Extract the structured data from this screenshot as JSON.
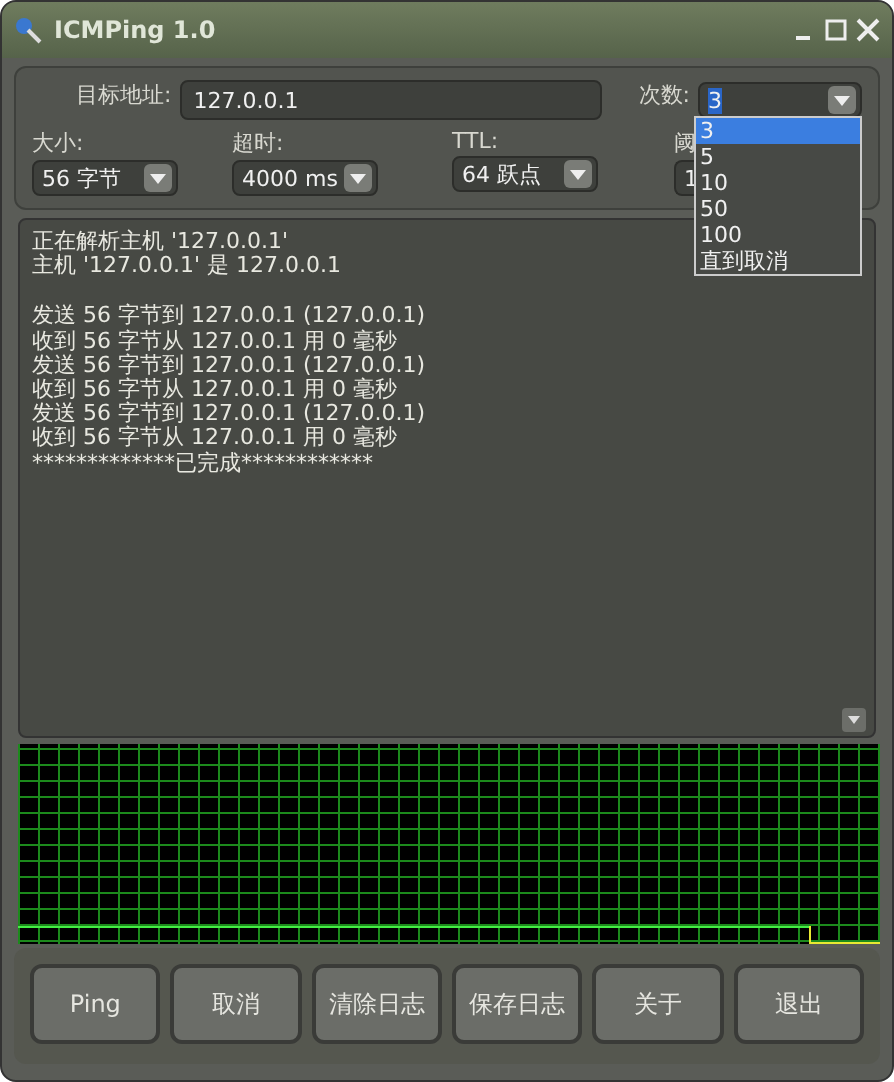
{
  "window": {
    "title": "ICMPing 1.0"
  },
  "target": {
    "label": "目标地址:",
    "value": "127.0.0.1"
  },
  "count": {
    "label": "次数:",
    "value": "3",
    "options": [
      {
        "label": "3",
        "selected": true
      },
      {
        "label": "5",
        "selected": false
      },
      {
        "label": "10",
        "selected": false
      },
      {
        "label": "50",
        "selected": false
      },
      {
        "label": "100",
        "selected": false
      },
      {
        "label": "直到取消",
        "selected": false
      }
    ]
  },
  "settings": [
    {
      "label": "大小:",
      "value": "56 字节"
    },
    {
      "label": "超时:",
      "value": "4000 ms"
    },
    {
      "label": "TTL:",
      "value": "64 跃点"
    },
    {
      "label": "阈",
      "value": "1",
      "hidden_by_list": true
    }
  ],
  "log": {
    "blocks": [
      [
        "正在解析主机 '127.0.0.1'",
        "主机 '127.0.0.1' 是 127.0.0.1"
      ],
      [
        "发送 56 字节到 127.0.0.1 (127.0.0.1)",
        "收到 56 字节从 127.0.0.1 用 0 毫秒",
        "发送 56 字节到 127.0.0.1 (127.0.0.1)",
        "收到 56 字节从 127.0.0.1 用 0 毫秒",
        "发送 56 字节到 127.0.0.1 (127.0.0.1)",
        "收到 56 字节从 127.0.0.1 用 0 毫秒",
        "*************已完成************"
      ]
    ]
  },
  "buttons": [
    "Ping",
    "取消",
    "清除日志",
    "保存日志",
    "关于",
    "退出"
  ]
}
